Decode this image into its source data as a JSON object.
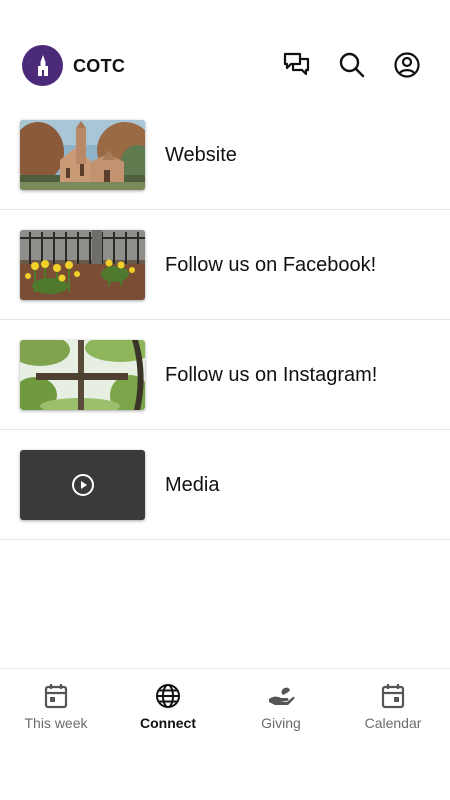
{
  "header": {
    "title": "COTC",
    "logo_icon": "church-steeple-icon",
    "actions": [
      {
        "name": "messages",
        "icon": "chat-bubbles-icon"
      },
      {
        "name": "search",
        "icon": "search-icon"
      },
      {
        "name": "profile",
        "icon": "account-circle-icon"
      }
    ]
  },
  "list": {
    "items": [
      {
        "label": "Website",
        "thumbnail": "church-building-photo"
      },
      {
        "label": "Follow us on Facebook!",
        "thumbnail": "daffodils-photo"
      },
      {
        "label": "Follow us on Instagram!",
        "thumbnail": "wooden-cross-photo"
      },
      {
        "label": "Media",
        "thumbnail": "video-play-tile"
      }
    ]
  },
  "bottom_nav": {
    "items": [
      {
        "label": "This week",
        "icon": "calendar-day-icon",
        "active": false
      },
      {
        "label": "Connect",
        "icon": "globe-icon",
        "active": true
      },
      {
        "label": "Giving",
        "icon": "giving-hand-icon",
        "active": false
      },
      {
        "label": "Calendar",
        "icon": "calendar-icon",
        "active": false
      }
    ]
  },
  "colors": {
    "brand": "#4b2a7a",
    "divider": "#e6e6e6",
    "inactive_text": "#6b6b6b",
    "active_text": "#111111",
    "media_tile": "#3a3a3a"
  }
}
